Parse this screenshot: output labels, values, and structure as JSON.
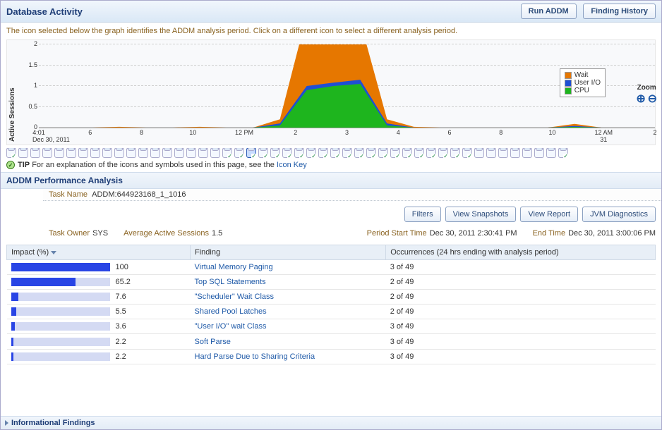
{
  "header": {
    "title": "Database Activity",
    "run_addm": "Run ADDM",
    "finding_history": "Finding History"
  },
  "hint": "The icon selected below the graph identifies the ADDM analysis period. Click on a different icon to select a different analysis period.",
  "chart_data": {
    "type": "area",
    "ylabel": "Active Sessions",
    "ylim": [
      0,
      2
    ],
    "yticks": [
      0,
      0.5,
      1,
      1.5,
      2
    ],
    "x_categories": [
      "4:01",
      "6",
      "8",
      "10",
      "12 PM",
      "2",
      "3",
      "4",
      "6",
      "8",
      "10",
      "12 AM",
      "2"
    ],
    "x_sub_label_left": "Dec 30, 2011",
    "x_sub_label_right": "31",
    "series": [
      {
        "name": "Wait",
        "color": "#e67700",
        "values": [
          0,
          0,
          0,
          0.02,
          0,
          0,
          0.02,
          0,
          0,
          0.1,
          1.7,
          1.9,
          1.4,
          0.1,
          0.02,
          0,
          0,
          0,
          0,
          0,
          0.05,
          0,
          0,
          0
        ]
      },
      {
        "name": "User I/O",
        "color": "#1f4fd4",
        "values": [
          0,
          0,
          0,
          0,
          0,
          0,
          0,
          0,
          0,
          0.05,
          0.1,
          0.08,
          0.1,
          0.05,
          0,
          0,
          0,
          0,
          0,
          0,
          0.02,
          0,
          0,
          0
        ]
      },
      {
        "name": "CPU",
        "color": "#1eb51e",
        "values": [
          0,
          0,
          0,
          0,
          0,
          0,
          0,
          0,
          0,
          0.05,
          0.9,
          1.0,
          1.05,
          0.05,
          0,
          0,
          0,
          0,
          0,
          0,
          0.02,
          0,
          0,
          0
        ]
      }
    ],
    "zoom_label": "Zoom"
  },
  "icon_strip": {
    "count": 47,
    "selected_index": 20,
    "checked_indices": [
      0,
      18,
      19,
      20,
      21,
      22,
      23,
      24,
      25,
      26,
      27,
      28,
      29,
      30,
      31,
      32,
      33,
      34,
      35,
      36,
      37,
      38,
      46
    ]
  },
  "tip": {
    "label": "TIP",
    "text": "For an explanation of the icons and symbols used in this page, see the ",
    "link": "Icon Key"
  },
  "analysis": {
    "header": "ADDM Performance Analysis",
    "task_name_label": "Task Name",
    "task_name": "ADDM:644923168_1_1016",
    "buttons": {
      "filters": "Filters",
      "view_snapshots": "View Snapshots",
      "view_report": "View Report",
      "jvm": "JVM Diagnostics"
    },
    "meta": {
      "task_owner_label": "Task Owner",
      "task_owner": "SYS",
      "aas_label": "Average Active Sessions",
      "aas": "1.5",
      "pst_label": "Period Start Time",
      "pst": "Dec 30, 2011 2:30:41 PM",
      "end_label": "End Time",
      "end": "Dec 30, 2011 3:00:06 PM"
    },
    "columns": {
      "impact": "Impact (%)",
      "finding": "Finding",
      "occurrences": "Occurrences (24 hrs ending with analysis period)"
    },
    "rows": [
      {
        "impact": 100,
        "finding": "Virtual Memory Paging",
        "occurrences": "3 of 49"
      },
      {
        "impact": 65.2,
        "finding": "Top SQL Statements",
        "occurrences": "2 of 49"
      },
      {
        "impact": 7.6,
        "finding": "\"Scheduler\" Wait Class",
        "occurrences": "2 of 49"
      },
      {
        "impact": 5.5,
        "finding": "Shared Pool Latches",
        "occurrences": "2 of 49"
      },
      {
        "impact": 3.6,
        "finding": "\"User I/O\" wait Class",
        "occurrences": "3 of 49"
      },
      {
        "impact": 2.2,
        "finding": "Soft Parse",
        "occurrences": "3 of 49"
      },
      {
        "impact": 2.2,
        "finding": "Hard Parse Due to Sharing Criteria",
        "occurrences": "3 of 49"
      }
    ]
  },
  "bottom": {
    "label": "Informational Findings"
  }
}
